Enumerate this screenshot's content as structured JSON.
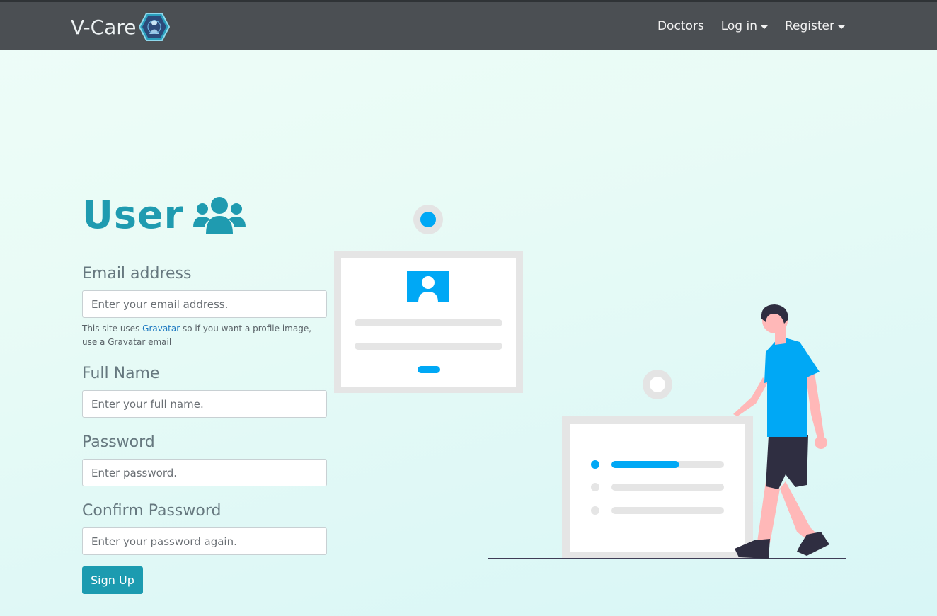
{
  "nav": {
    "brand": "V-Care",
    "links": [
      {
        "label": "Doctors",
        "dropdown": false
      },
      {
        "label": "Log in",
        "dropdown": true
      },
      {
        "label": "Register",
        "dropdown": true
      }
    ]
  },
  "form": {
    "title": "User",
    "title_icon": "users-icon",
    "email": {
      "label": "Email address",
      "placeholder": "Enter your email address.",
      "helper_prefix": "This site uses ",
      "helper_link": "Gravatar",
      "helper_suffix": " so if you want a profile image, use a Gravatar email"
    },
    "full_name": {
      "label": "Full Name",
      "placeholder": "Enter your full name."
    },
    "password": {
      "label": "Password",
      "placeholder": "Enter password."
    },
    "confirm_password": {
      "label": "Confirm Password",
      "placeholder": "Enter your password again."
    },
    "submit_label": "Sign Up"
  },
  "colors": {
    "accent": "#1c9bb0",
    "nav_bg": "#4b4f53",
    "illustration_blue": "#00a8f5"
  },
  "illustration": {
    "progress_fraction": 0.6
  }
}
